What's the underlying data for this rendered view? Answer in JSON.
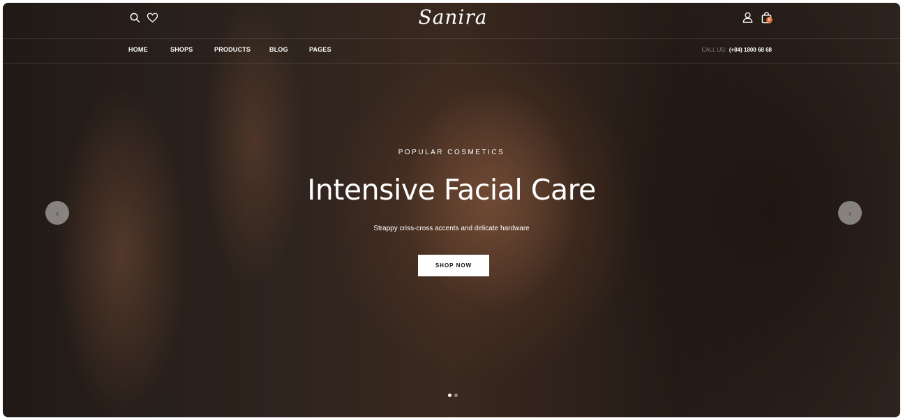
{
  "header": {
    "logo_text": "Sanira",
    "icons": {
      "search": "search-icon",
      "wishlist": "heart-icon",
      "account": "user-icon",
      "cart": "shopping-bag-icon"
    },
    "cart_count": "0",
    "cart_badge_color": "#e06b2a"
  },
  "nav": {
    "items": [
      {
        "label": "HOME"
      },
      {
        "label": "SHOPS"
      },
      {
        "label": "PRODUCTS"
      },
      {
        "label": "BLOG"
      },
      {
        "label": "PAGES"
      }
    ],
    "call_label": "CALL US:",
    "call_number": "(+84) 1800 68 68"
  },
  "hero": {
    "eyebrow": "POPULAR COSMETICS",
    "title": "Intensive Facial Care",
    "subtitle": "Strappy criss-cross accents and delicate hardware",
    "cta_label": "SHOP NOW",
    "prev_icon": "‹",
    "next_icon": "›",
    "slide_count": 2,
    "active_slide": 1
  }
}
